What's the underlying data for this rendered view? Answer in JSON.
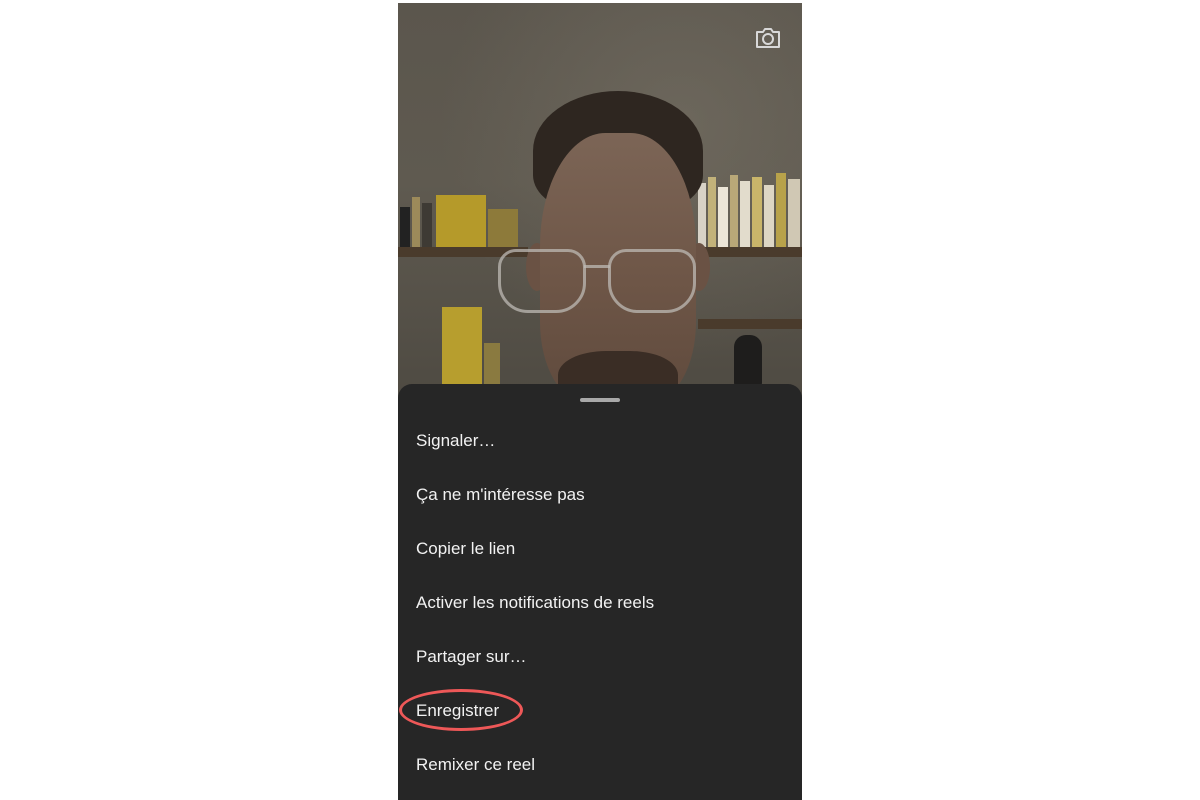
{
  "preview": {
    "camera_icon": "camera-icon"
  },
  "sheet": {
    "items": [
      {
        "label": "Signaler…"
      },
      {
        "label": "Ça ne m'intéresse pas"
      },
      {
        "label": "Copier le lien"
      },
      {
        "label": "Activer les notifications de reels"
      },
      {
        "label": "Partager sur…"
      },
      {
        "label": "Enregistrer",
        "highlighted": true
      },
      {
        "label": "Remixer ce reel"
      }
    ],
    "highlight_color": "#ee5858",
    "background": "#262626"
  }
}
